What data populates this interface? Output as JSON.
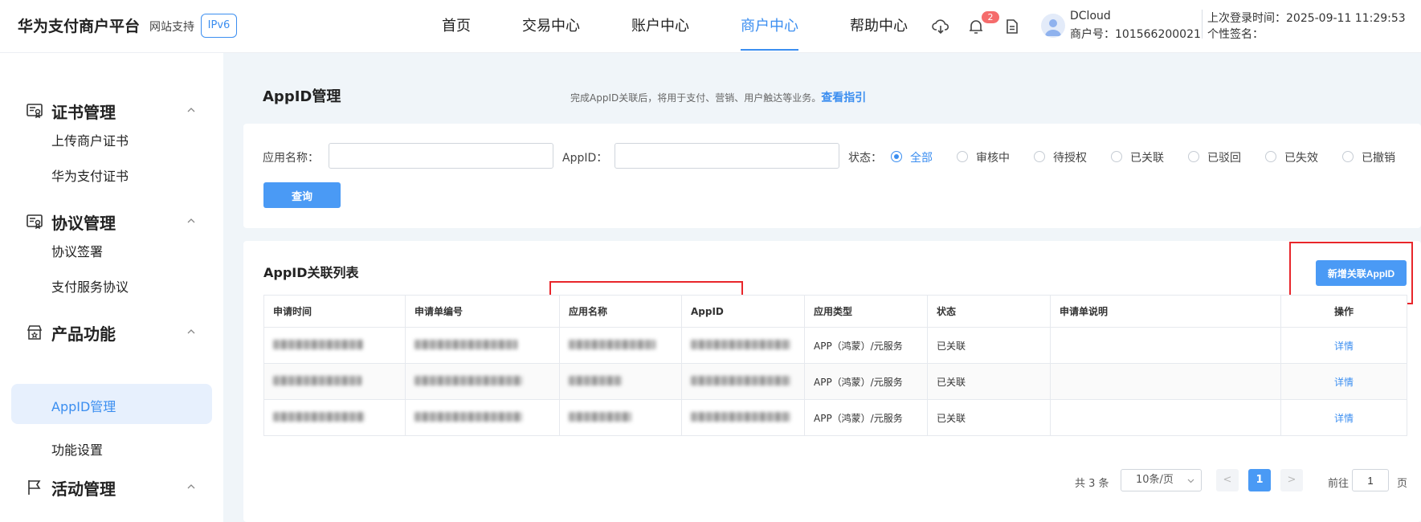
{
  "header": {
    "brand": "华为支付商户平台",
    "support_label": "网站支持",
    "ipv6_badge": "IPv6",
    "nav": [
      "首页",
      "交易中心",
      "账户中心",
      "商户中心",
      "帮助中心"
    ],
    "active_nav": "商户中心",
    "notification_count": "2",
    "user_name": "DCloud",
    "merchant_id": "商户号：101566200021",
    "last_login": "上次登录时间：2025-09-11 11:29:53",
    "signature": "个性签名："
  },
  "sidebar": {
    "sections": [
      {
        "title": "证书管理",
        "icon": "certificate-icon",
        "items": [
          "上传商户证书",
          "华为支付证书"
        ]
      },
      {
        "title": "协议管理",
        "icon": "contract-icon",
        "items": [
          "协议签署",
          "支付服务协议"
        ]
      },
      {
        "title": "产品功能",
        "icon": "product-icon",
        "items": [
          "AppID管理",
          "功能设置"
        ]
      },
      {
        "title": "活动管理",
        "icon": "flag-icon",
        "items": []
      }
    ],
    "active_item": "AppID管理"
  },
  "page": {
    "title": "AppID管理",
    "description": "完成AppID关联后，将用于支付、营销、用户触达等业务。",
    "guide_link": "查看指引"
  },
  "filter": {
    "app_name_label": "应用名称：",
    "app_name_value": "",
    "appid_label": "AppID：",
    "appid_value": "",
    "status_label": "状态：",
    "status_options": [
      "全部",
      "审核中",
      "待授权",
      "已关联",
      "已驳回",
      "已失效",
      "已撤销"
    ],
    "selected_status": "全部",
    "query_button": "查询"
  },
  "list": {
    "title": "AppID关联列表",
    "add_button": "新增关联AppID",
    "columns": [
      "申请时间",
      "申请单编号",
      "应用名称",
      "AppID",
      "应用类型",
      "状态",
      "申请单说明",
      "操作"
    ],
    "rows": [
      {
        "app_type": "APP（鸿蒙）/元服务",
        "status": "已关联",
        "remark": "",
        "action": "详情"
      },
      {
        "app_type": "APP（鸿蒙）/元服务",
        "status": "已关联",
        "remark": "",
        "action": "详情"
      },
      {
        "app_type": "APP（鸿蒙）/元服务",
        "status": "已关联",
        "remark": "",
        "action": "详情"
      }
    ]
  },
  "pagination": {
    "total": "共 3 条",
    "page_size": "10条/页",
    "prev": "<",
    "current_page": "1",
    "next": ">",
    "goto_label": "前往",
    "goto_value": "1",
    "page_suffix": "页"
  },
  "colors": {
    "accent": "#3b8ef0",
    "button": "#4a9af5",
    "annotation_red": "#e8262b",
    "badge_red": "#f56c6c"
  }
}
